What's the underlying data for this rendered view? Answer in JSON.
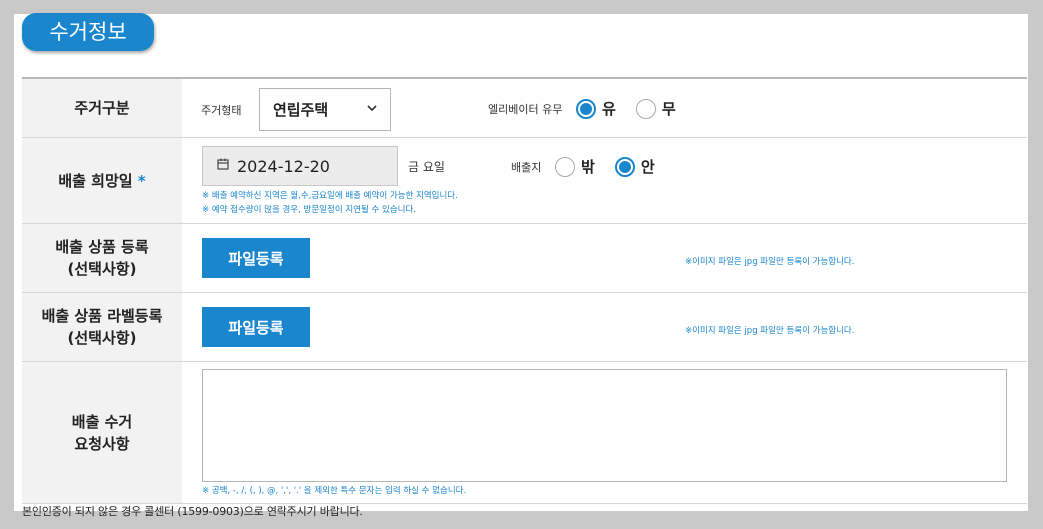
{
  "section_title": "수거정보",
  "rows": {
    "housing": {
      "label": "주거구분",
      "type_label": "주거형태",
      "type_value": "연립주택",
      "elevator_label": "엘리베이터 유무",
      "elevator_options": [
        "유",
        "무"
      ],
      "elevator_selected": "유"
    },
    "date": {
      "label": "배출 희망일",
      "required_mark": "*",
      "date_value": "2024-12-20",
      "day_label": "금  요일",
      "location_label": "배출지",
      "location_options": [
        "밖",
        "안"
      ],
      "location_selected": "안",
      "note_1": "※ 배출 예약하신 지역은 월,수,금요일에 배출 예약이 가능한 지역입니다.",
      "note_2": "※ 예약 접수량이 많을 경우, 방문일정이 지연될 수 있습니다."
    },
    "product": {
      "label_line1": "배출 상품 등록",
      "label_line2": "(선택사항)",
      "button": "파일등록",
      "note": "※이미지 파일은 jpg 파일만 등록이 가능합니다."
    },
    "label_reg": {
      "label_line1": "배출 상품 라벨등록",
      "label_line2": "(선택사항)",
      "button": "파일등록",
      "note": "※이미지 파일은 jpg 파일만 등록이 가능합니다."
    },
    "request": {
      "label_line1": "배출 수거",
      "label_line2": "요청사항",
      "textarea_value": "",
      "note": "※ 공백, -, /, (, ), @, ',', '.' 을 제외한 특수 문자는 입력 하실 수 없습니다."
    }
  },
  "footer_note": "본인인증이 되지 않은 경우 콜센터 (1599-0903)으로 연락주시기 바랍니다.",
  "icons": {
    "calendar": "calendar-icon",
    "dropdown": "chevron-down-icon"
  },
  "colors": {
    "accent": "#1a86cd",
    "header_bg": "#f2f2f2",
    "background": "#c9c9c9"
  }
}
